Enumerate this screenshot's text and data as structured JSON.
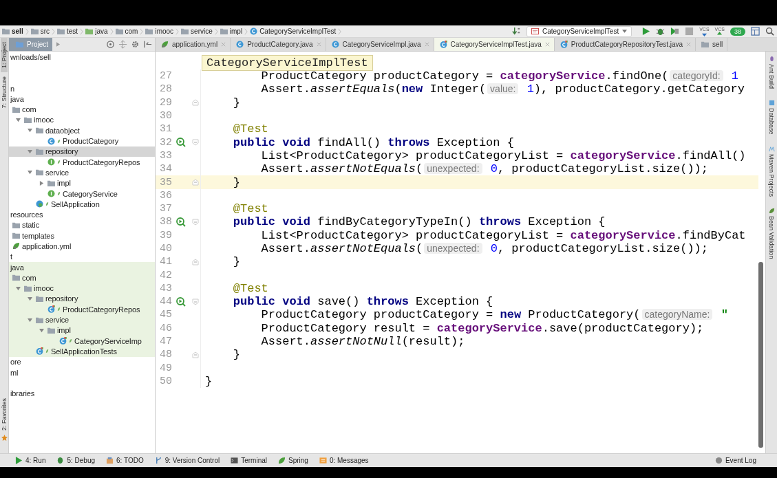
{
  "breadcrumbs": [
    {
      "label": "sell",
      "kind": "module"
    },
    {
      "label": "src",
      "kind": "folder"
    },
    {
      "label": "test",
      "kind": "folder"
    },
    {
      "label": "java",
      "kind": "test-folder"
    },
    {
      "label": "com",
      "kind": "folder"
    },
    {
      "label": "imooc",
      "kind": "folder"
    },
    {
      "label": "service",
      "kind": "folder"
    },
    {
      "label": "impl",
      "kind": "folder"
    },
    {
      "label": "CategoryServiceImplTest",
      "kind": "test-class"
    }
  ],
  "toolbar": [
    {
      "kind": "sort"
    },
    {
      "kind": "config",
      "label": "CategoryServiceImplTest"
    },
    {
      "kind": "run"
    },
    {
      "kind": "debug"
    },
    {
      "kind": "coverage"
    },
    {
      "kind": "stop"
    },
    {
      "kind": "vcs-update",
      "label": "VCS"
    },
    {
      "kind": "vcs-commit",
      "label": "VCS"
    },
    {
      "kind": "badge",
      "label": "38"
    },
    {
      "kind": "structure"
    },
    {
      "kind": "search"
    }
  ],
  "left_strip": [
    {
      "label": "1: Project",
      "selected": true
    },
    {
      "label": "7: Structure",
      "selected": false
    },
    {
      "label": "2: Favorites",
      "selected": false
    }
  ],
  "project": {
    "tab": "Project",
    "tree": [
      {
        "label": "wnloads/sell",
        "selected": false
      },
      {
        "label": "n",
        "selected": false,
        "children": [
          {
            "label": "java",
            "selected": false,
            "test_sources": false,
            "children": [
              {
                "label": "com",
                "kind": "folder",
                "selected": false,
                "children": [
                  {
                    "label": "imooc",
                    "kind": "folder",
                    "expanded": true,
                    "selected": false,
                    "children": [
                      {
                        "label": "dataobject",
                        "kind": "folder",
                        "expanded": true,
                        "selected": false,
                        "children": [
                          {
                            "label": "ProductCategory",
                            "kind": "class",
                            "selected": false
                          }
                        ]
                      },
                      {
                        "label": "repository",
                        "kind": "folder",
                        "expanded": true,
                        "selected": true,
                        "children": [
                          {
                            "label": "ProductCategoryRepos",
                            "kind": "interface",
                            "selected": false
                          }
                        ]
                      },
                      {
                        "label": "service",
                        "kind": "folder",
                        "expanded": true,
                        "selected": false,
                        "children": [
                          {
                            "label": "impl",
                            "kind": "folder",
                            "expanded": false,
                            "selected": false
                          },
                          {
                            "label": "CategoryService",
                            "kind": "interface",
                            "selected": false
                          }
                        ]
                      },
                      {
                        "label": "SellApplication",
                        "kind": "spring-app",
                        "selected": false
                      }
                    ]
                  }
                ]
              }
            ]
          },
          {
            "label": "resources",
            "selected": false,
            "children": [
              {
                "label": "static",
                "kind": "folder",
                "selected": false
              },
              {
                "label": "templates",
                "kind": "folder",
                "selected": false
              },
              {
                "label": "application.yml",
                "kind": "yml",
                "selected": false
              }
            ]
          }
        ]
      },
      {
        "label": "t",
        "selected": false,
        "children": [
          {
            "label": "java",
            "selected": false,
            "test_sources": true,
            "children": [
              {
                "label": "com",
                "kind": "folder",
                "selected": false,
                "children": [
                  {
                    "label": "imooc",
                    "kind": "folder",
                    "expanded": true,
                    "selected": false,
                    "children": [
                      {
                        "label": "repository",
                        "kind": "folder",
                        "expanded": true,
                        "selected": false,
                        "children": [
                          {
                            "label": "ProductCategoryRepos",
                            "kind": "test-class",
                            "selected": false
                          }
                        ]
                      },
                      {
                        "label": "service",
                        "kind": "folder",
                        "expanded": true,
                        "selected": false,
                        "children": [
                          {
                            "label": "impl",
                            "kind": "folder",
                            "expanded": true,
                            "selected": false,
                            "children": [
                              {
                                "label": "CategoryServiceImp",
                                "kind": "test-class",
                                "selected": false
                              }
                            ]
                          }
                        ]
                      },
                      {
                        "label": "SellApplicationTests",
                        "kind": "test-class",
                        "selected": false
                      }
                    ]
                  }
                ]
              }
            ]
          }
        ]
      },
      {
        "label": "ore",
        "selected": false
      },
      {
        "label": "ml",
        "selected": false
      },
      {
        "label": "ibraries",
        "selected": false
      }
    ]
  },
  "tabs": [
    {
      "label": "application.yml",
      "kind": "yml",
      "selected": false,
      "closable": true
    },
    {
      "label": "ProductCategory.java",
      "kind": "class",
      "selected": false,
      "closable": true
    },
    {
      "label": "CategoryServiceImpl.java",
      "kind": "class",
      "selected": false,
      "closable": true
    },
    {
      "label": "CategoryServiceImplTest.java",
      "kind": "test-class",
      "selected": true,
      "closable": true
    },
    {
      "label": "ProductCategoryRepositoryTest.java",
      "kind": "test-class",
      "selected": false,
      "closable": true
    },
    {
      "label": "sell",
      "kind": "module",
      "selected": false,
      "closable": false
    }
  ],
  "tooltip": "CategoryServiceImplTest",
  "editor": {
    "lines": [
      {
        "number": "27",
        "kind": "plain",
        "current": false,
        "run": false,
        "segments": [
          {
            "kind": "text",
            "text": "        ProductCategory productCategory = "
          },
          {
            "kind": "field",
            "text": "categoryService"
          },
          {
            "kind": "text",
            "text": ".findOne("
          },
          {
            "kind": "hint",
            "text": "categoryId:"
          },
          {
            "kind": "number",
            "text": " 1"
          }
        ]
      },
      {
        "number": "28",
        "kind": "plain",
        "current": false,
        "run": false,
        "segments": [
          {
            "kind": "text",
            "text": "        Assert."
          },
          {
            "kind": "static",
            "text": "assertEquals"
          },
          {
            "kind": "text",
            "text": "("
          },
          {
            "kind": "keyword",
            "text": "new"
          },
          {
            "kind": "text",
            "text": " Integer("
          },
          {
            "kind": "hint",
            "text": "value:"
          },
          {
            "kind": "number",
            "text": " 1"
          },
          {
            "kind": "text",
            "text": "), productCategory.getCategory"
          }
        ]
      },
      {
        "number": "29",
        "kind": "fold-end",
        "current": false,
        "run": false,
        "segments": [
          {
            "kind": "text",
            "text": "    }"
          }
        ]
      },
      {
        "number": "30",
        "kind": "plain",
        "current": false,
        "run": false
      },
      {
        "number": "31",
        "kind": "plain",
        "current": false,
        "run": false,
        "segments": [
          {
            "kind": "annotation",
            "text": "    @Test"
          }
        ]
      },
      {
        "number": "32",
        "kind": "fold-start",
        "current": false,
        "run": true,
        "segments": [
          {
            "kind": "keyword",
            "text": "    public void"
          },
          {
            "kind": "text",
            "text": " findAll() "
          },
          {
            "kind": "keyword",
            "text": "throws"
          },
          {
            "kind": "text",
            "text": " Exception {"
          }
        ]
      },
      {
        "number": "33",
        "kind": "plain",
        "current": false,
        "run": false,
        "segments": [
          {
            "kind": "text",
            "text": "        List<ProductCategory> productCategoryList = "
          },
          {
            "kind": "field",
            "text": "categoryService"
          },
          {
            "kind": "text",
            "text": ".findAll()"
          }
        ]
      },
      {
        "number": "34",
        "kind": "plain",
        "current": false,
        "run": false,
        "segments": [
          {
            "kind": "text",
            "text": "        Assert."
          },
          {
            "kind": "static",
            "text": "assertNotEquals"
          },
          {
            "kind": "text",
            "text": "("
          },
          {
            "kind": "hint",
            "text": "unexpected:"
          },
          {
            "kind": "number",
            "text": " 0"
          },
          {
            "kind": "text",
            "text": ", productCategoryList.size());"
          }
        ]
      },
      {
        "number": "35",
        "kind": "fold-end",
        "current": true,
        "run": false,
        "segments": [
          {
            "kind": "text",
            "text": "    }"
          }
        ]
      },
      {
        "number": "36",
        "kind": "plain",
        "current": false,
        "run": false
      },
      {
        "number": "37",
        "kind": "plain",
        "current": false,
        "run": false,
        "segments": [
          {
            "kind": "annotation",
            "text": "    @Test"
          }
        ]
      },
      {
        "number": "38",
        "kind": "fold-start",
        "current": false,
        "run": true,
        "segments": [
          {
            "kind": "keyword",
            "text": "    public void"
          },
          {
            "kind": "text",
            "text": " findByCategoryTypeIn() "
          },
          {
            "kind": "keyword",
            "text": "throws"
          },
          {
            "kind": "text",
            "text": " Exception {"
          }
        ]
      },
      {
        "number": "39",
        "kind": "plain",
        "current": false,
        "run": false,
        "segments": [
          {
            "kind": "text",
            "text": "        List<ProductCategory> productCategoryList = "
          },
          {
            "kind": "field",
            "text": "categoryService"
          },
          {
            "kind": "text",
            "text": ".findByCat"
          }
        ]
      },
      {
        "number": "40",
        "kind": "plain",
        "current": false,
        "run": false,
        "segments": [
          {
            "kind": "text",
            "text": "        Assert."
          },
          {
            "kind": "static",
            "text": "assertNotEquals"
          },
          {
            "kind": "text",
            "text": "("
          },
          {
            "kind": "hint",
            "text": "unexpected:"
          },
          {
            "kind": "number",
            "text": " 0"
          },
          {
            "kind": "text",
            "text": ", productCategoryList.size());"
          }
        ]
      },
      {
        "number": "41",
        "kind": "fold-end",
        "current": false,
        "run": false,
        "segments": [
          {
            "kind": "text",
            "text": "    }"
          }
        ]
      },
      {
        "number": "42",
        "kind": "plain",
        "current": false,
        "run": false
      },
      {
        "number": "43",
        "kind": "plain",
        "current": false,
        "run": false,
        "segments": [
          {
            "kind": "annotation",
            "text": "    @Test"
          }
        ]
      },
      {
        "number": "44",
        "kind": "fold-start",
        "current": false,
        "run": true,
        "segments": [
          {
            "kind": "keyword",
            "text": "    public void"
          },
          {
            "kind": "text",
            "text": " save() "
          },
          {
            "kind": "keyword",
            "text": "throws"
          },
          {
            "kind": "text",
            "text": " Exception {"
          }
        ]
      },
      {
        "number": "45",
        "kind": "plain",
        "current": false,
        "run": false,
        "segments": [
          {
            "kind": "text",
            "text": "        ProductCategory productCategory = "
          },
          {
            "kind": "keyword",
            "text": "new"
          },
          {
            "kind": "text",
            "text": " ProductCategory("
          },
          {
            "kind": "hint",
            "text": "categoryName:"
          },
          {
            "kind": "string",
            "text": " \""
          }
        ]
      },
      {
        "number": "46",
        "kind": "plain",
        "current": false,
        "run": false,
        "segments": [
          {
            "kind": "text",
            "text": "        ProductCategory result = "
          },
          {
            "kind": "field",
            "text": "categoryService"
          },
          {
            "kind": "text",
            "text": ".save(productCategory);"
          }
        ]
      },
      {
        "number": "47",
        "kind": "plain",
        "current": false,
        "run": false,
        "segments": [
          {
            "kind": "text",
            "text": "        Assert."
          },
          {
            "kind": "static",
            "text": "assertNotNull"
          },
          {
            "kind": "text",
            "text": "(result);"
          }
        ]
      },
      {
        "number": "48",
        "kind": "fold-end",
        "current": false,
        "run": false,
        "segments": [
          {
            "kind": "text",
            "text": "    }"
          }
        ]
      },
      {
        "number": "49",
        "kind": "plain",
        "current": false,
        "run": false
      },
      {
        "number": "50",
        "kind": "plain",
        "current": false,
        "run": false,
        "segments": [
          {
            "kind": "text",
            "text": "}"
          }
        ]
      }
    ]
  },
  "right_strip": [
    {
      "label": "Ant Build",
      "kind": "ant"
    },
    {
      "label": "Database",
      "kind": "database"
    },
    {
      "label": "Maven Projects",
      "kind": "maven"
    },
    {
      "label": "Bean Validation",
      "kind": "bean"
    }
  ],
  "bottom_bar": [
    {
      "label": "4: Run",
      "kind": "run"
    },
    {
      "label": "5: Debug",
      "kind": "debug"
    },
    {
      "label": "6: TODO",
      "kind": "todo"
    },
    {
      "label": "9: Version Control",
      "kind": "vcs"
    },
    {
      "label": "Terminal",
      "kind": "terminal"
    },
    {
      "label": "Spring",
      "kind": "spring"
    },
    {
      "label": "0: Messages",
      "kind": "messages"
    }
  ],
  "event_log": "Event Log"
}
